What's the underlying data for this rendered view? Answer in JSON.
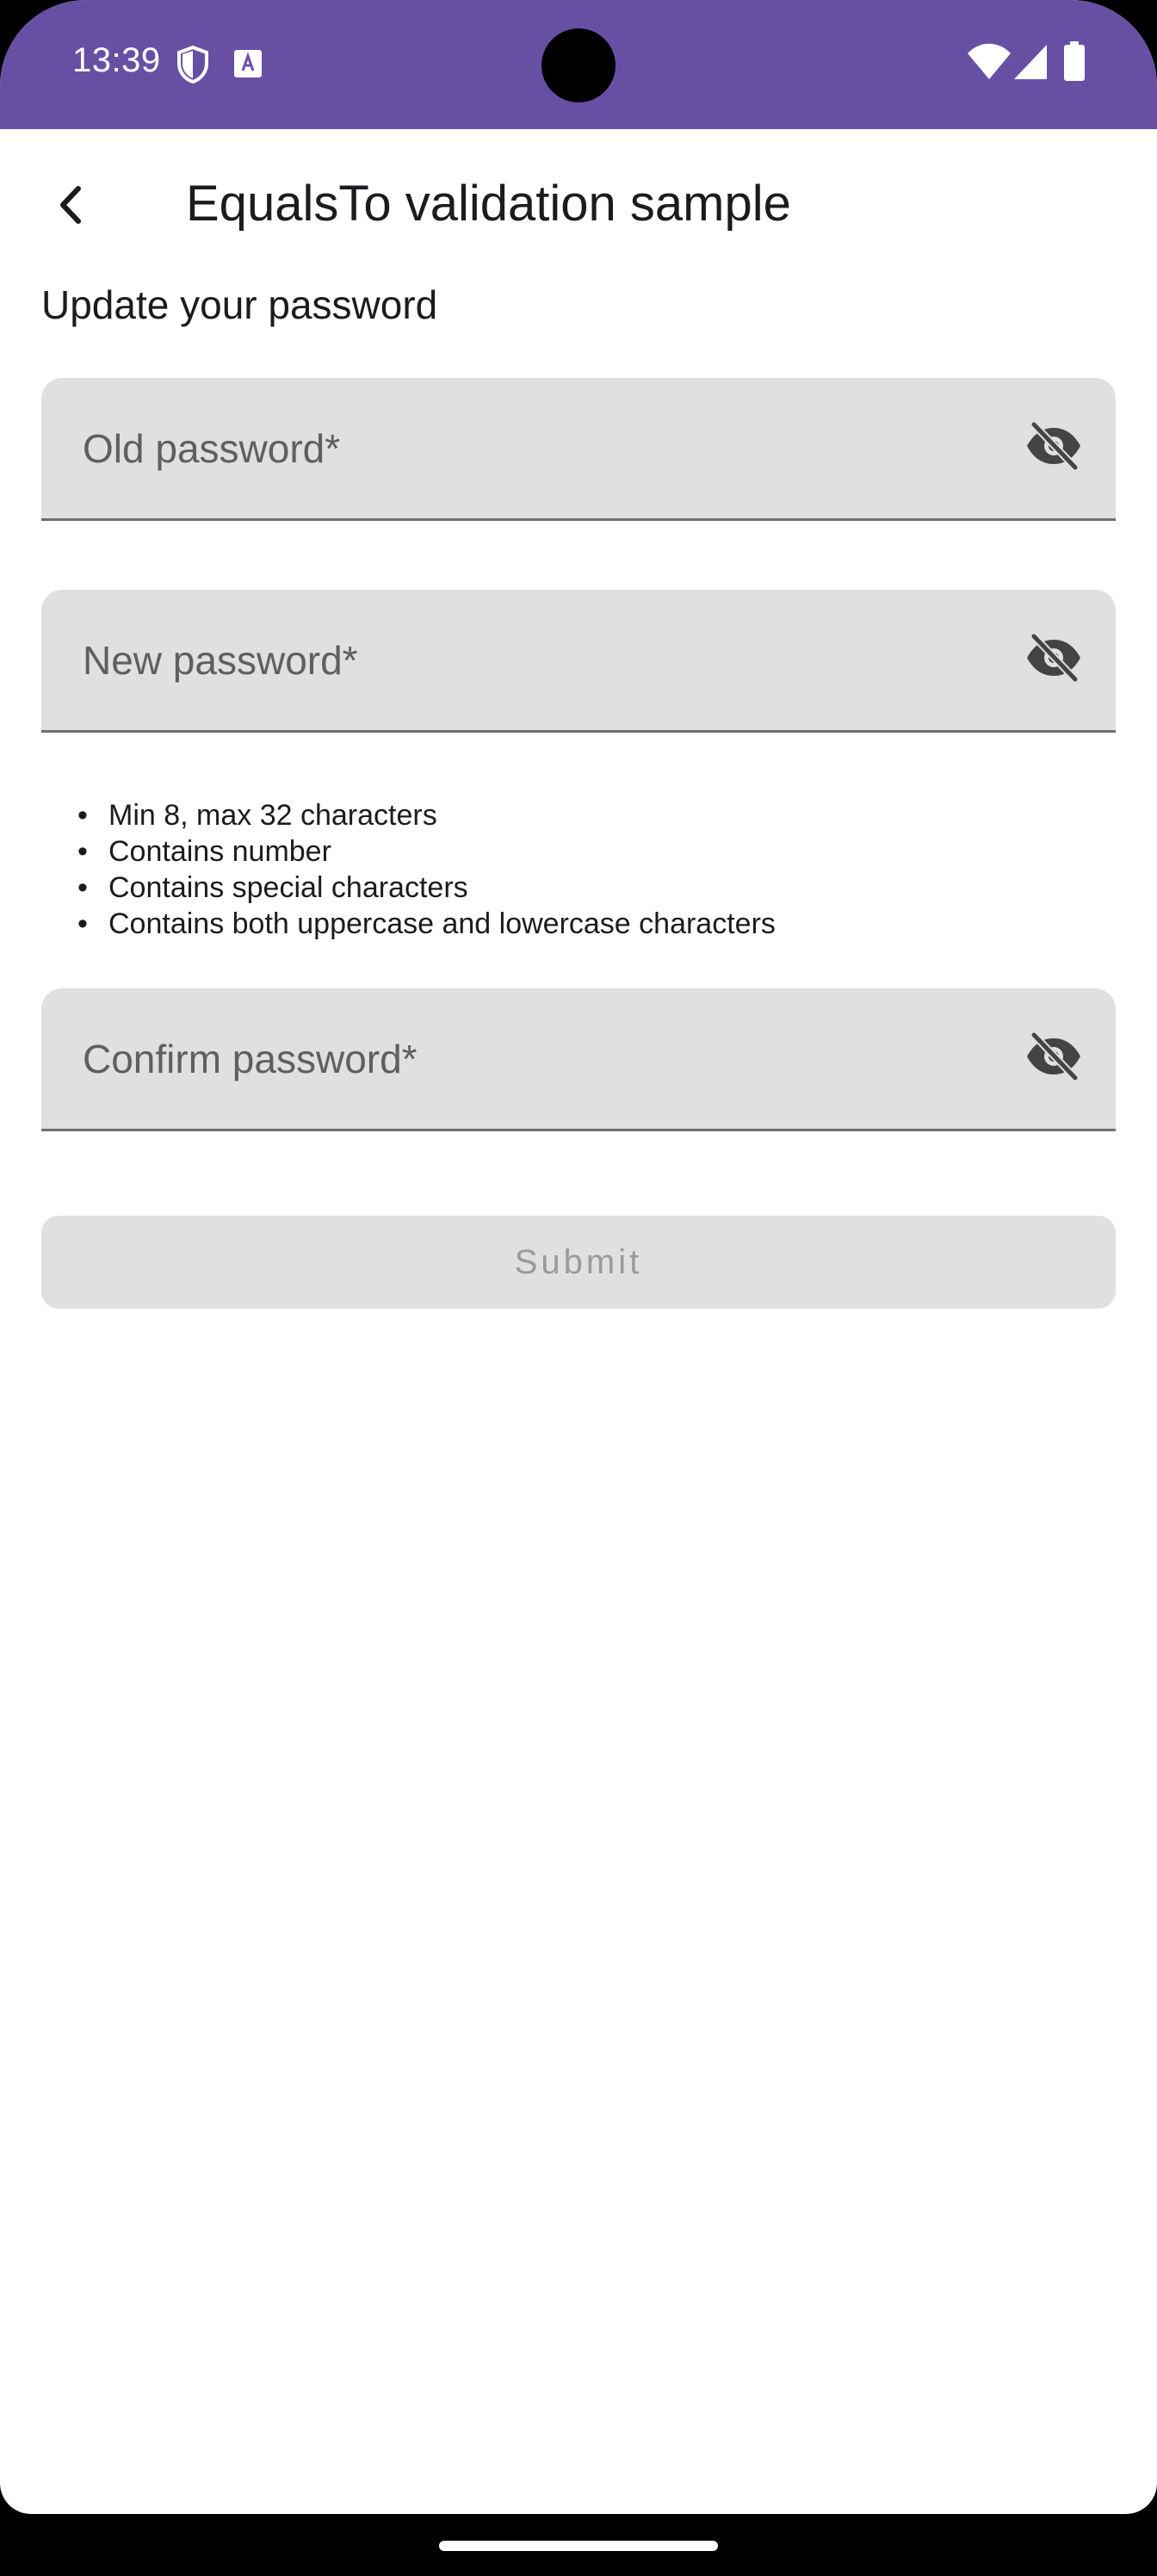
{
  "status_bar": {
    "time": "13:39",
    "icons_left": [
      "shield-icon",
      "keyboard-a-icon"
    ],
    "icons_right": [
      "wifi-icon",
      "cell-signal-icon",
      "battery-icon"
    ],
    "background_color": "#6750a4"
  },
  "app_bar": {
    "back_icon": "chevron-left-icon",
    "title": "EqualsTo validation sample"
  },
  "form": {
    "section_title": "Update your password",
    "old_password": {
      "label": "Old password*",
      "value": "",
      "toggle_icon": "eye-off-icon"
    },
    "new_password": {
      "label": "New password*",
      "value": "",
      "toggle_icon": "eye-off-icon"
    },
    "rules_bullet": "•",
    "rules": [
      "Min 8, max 32 characters",
      "Contains number",
      "Contains special characters",
      "Contains both uppercase and lowercase characters"
    ],
    "confirm_password": {
      "label": "Confirm password*",
      "value": "",
      "toggle_icon": "eye-off-icon"
    },
    "submit_label": "Submit",
    "submit_enabled": false
  }
}
